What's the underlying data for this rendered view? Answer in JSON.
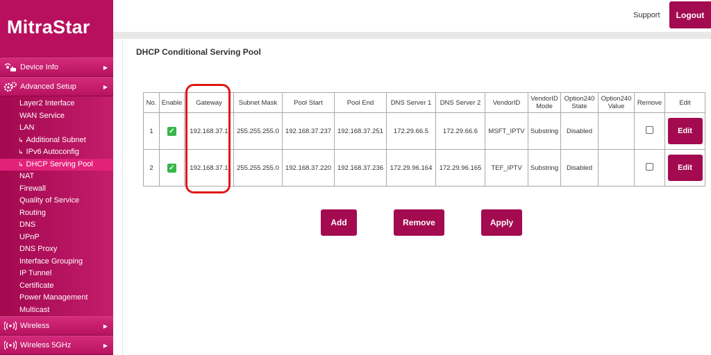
{
  "brand": {
    "logo": "MitraStar"
  },
  "header": {
    "support_label": "Support",
    "logout_label": "Logout"
  },
  "sidebar": {
    "device_info": "Device Info",
    "advanced_setup": "Advanced Setup",
    "items": [
      "Layer2 Interface",
      "WAN Service",
      "LAN",
      "Additional Subnet",
      "IPv6 Autoconfig",
      "DHCP Serving Pool",
      "NAT",
      "Firewall",
      "Quality of Service",
      "Routing",
      "DNS",
      "UPnP",
      "DNS Proxy",
      "Interface Grouping",
      "IP Tunnel",
      "Certificate",
      "Power Management",
      "Multicast"
    ],
    "wireless": "Wireless",
    "wireless5": "Wireless 5GHz"
  },
  "page": {
    "title": "DHCP Conditional Serving Pool"
  },
  "table": {
    "headers": [
      "No.",
      "Enable",
      "Gateway",
      "Subnet Mask",
      "Pool Start",
      "Pool End",
      "DNS Server 1",
      "DNS Server 2",
      "VendorID",
      "VendorID Mode",
      "Option240 State",
      "Option240 Value",
      "Remove",
      "Edit"
    ],
    "rows": [
      {
        "no": "1",
        "enabled": true,
        "gateway": "192.168.37.1",
        "subnet": "255.255.255.0",
        "pool_start": "192.168.37.237",
        "pool_end": "192.168.37.251",
        "dns1": "172.29.66.5",
        "dns2": "172.29.66.6",
        "vendor": "MSFT_IPTV",
        "vendor_mode": "Substring",
        "opt_state": "Disabled",
        "opt_value": "",
        "remove": false,
        "edit": "Edit"
      },
      {
        "no": "2",
        "enabled": true,
        "gateway": "192.168.37.1",
        "subnet": "255.255.255.0",
        "pool_start": "192.168.37.220",
        "pool_end": "192.168.37.236",
        "dns1": "172.29.96.164",
        "dns2": "172.29.96.165",
        "vendor": "TEF_IPTV",
        "vendor_mode": "Substring",
        "opt_state": "Disabled",
        "opt_value": "",
        "remove": false,
        "edit": "Edit"
      }
    ]
  },
  "actions": {
    "add": "Add",
    "remove": "Remove",
    "apply": "Apply"
  },
  "colors": {
    "brand": "#a30a4f",
    "active_menu": "#e2227a",
    "highlight": "#e01616",
    "check": "#39b54a"
  }
}
